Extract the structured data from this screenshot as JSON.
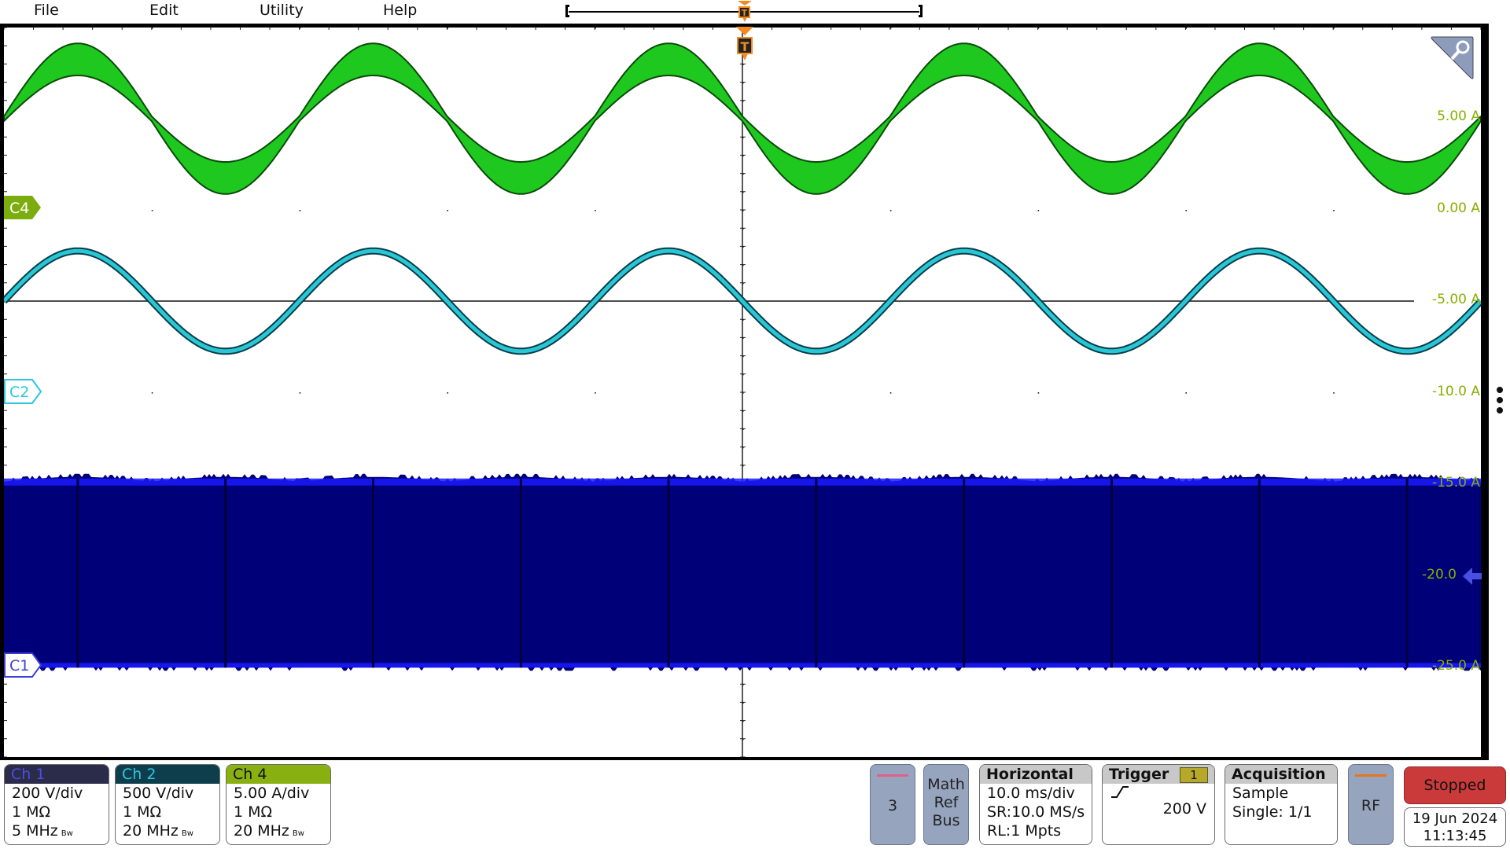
{
  "menu": {
    "items": [
      "File",
      "Edit",
      "Utility",
      "Help"
    ]
  },
  "trigger_marker": {
    "label": "T",
    "color": "#f28c1f"
  },
  "zoom_icon": "magnifier-icon",
  "more_icon": "vertical-ellipsis-icon",
  "chart_data": {
    "type": "line",
    "title": "",
    "grid": true,
    "x_divisions": 10,
    "y_divisions": 8,
    "x_unit": "ms",
    "x_per_div": 10.0,
    "xlim": [
      -50,
      50
    ],
    "y_axis_labels": [
      "5.00 A",
      "0.00 A",
      "-5.00 A",
      "-10.0 A",
      "-15.0 A",
      "-20.0",
      "-25.0 A"
    ],
    "y_axis_label_color": "#86b000",
    "series": [
      {
        "name": "C4",
        "color": "#1ec81e",
        "label_color": "#7cad0f",
        "type": "sine-band",
        "offset_div": 3,
        "amplitude_div": 0.65,
        "band_div": 0.3,
        "period_ms": 20,
        "phase_deg": 180
      },
      {
        "name": "C2",
        "color": "#29c7d6",
        "label_color": "#25bfe0",
        "type": "sine",
        "offset_div": 1,
        "amplitude_div": 0.55,
        "period_ms": 20,
        "phase_deg": 180
      },
      {
        "name": "C1",
        "color": "#000078",
        "edge_color": "#1a1aff",
        "label_color": "#3d3fd6",
        "type": "pwm-envelope",
        "top_div": -0.98,
        "bottom_div": -3.02,
        "period_ms": 10
      }
    ],
    "ch1_offset_marker": {
      "label": "-20.0",
      "side": "right"
    }
  },
  "channels": [
    {
      "name": "Ch 1",
      "scale": "200 V/div",
      "impedance": "1 MΩ",
      "bandwidth": "5 MHz",
      "bw_mark": "Bw",
      "header_bg": "#2b2b4a",
      "header_fg": "#4b4fe0"
    },
    {
      "name": "Ch 2",
      "scale": "500 V/div",
      "impedance": "1 MΩ",
      "bandwidth": "20 MHz",
      "bw_mark": "Bw",
      "header_bg": "#0e3e4c",
      "header_fg": "#2dc8e6"
    },
    {
      "name": "Ch 4",
      "scale": "5.00 A/div",
      "impedance": "1 MΩ",
      "bandwidth": "20 MHz",
      "bw_mark": "Bw",
      "header_bg": "#88b010",
      "header_fg": "#111111"
    }
  ],
  "buttons": {
    "ch3": "3",
    "math": [
      "Math",
      "Ref",
      "Bus"
    ],
    "rf": "RF"
  },
  "horizontal": {
    "title": "Horizontal",
    "scale": "10.0 ms/div",
    "sample_rate": "SR:10.0 MS/s",
    "record_length": "RL:1 Mpts"
  },
  "trigger": {
    "title": "Trigger",
    "source": "1",
    "slope": "rising",
    "level": "200 V"
  },
  "acquisition": {
    "title": "Acquisition",
    "mode": "Sample",
    "count": "Single: 1/1"
  },
  "status": {
    "label": "Stopped",
    "color": "#cb3a3a"
  },
  "datetime": {
    "date": "19 Jun 2024",
    "time": "11:13:45"
  }
}
